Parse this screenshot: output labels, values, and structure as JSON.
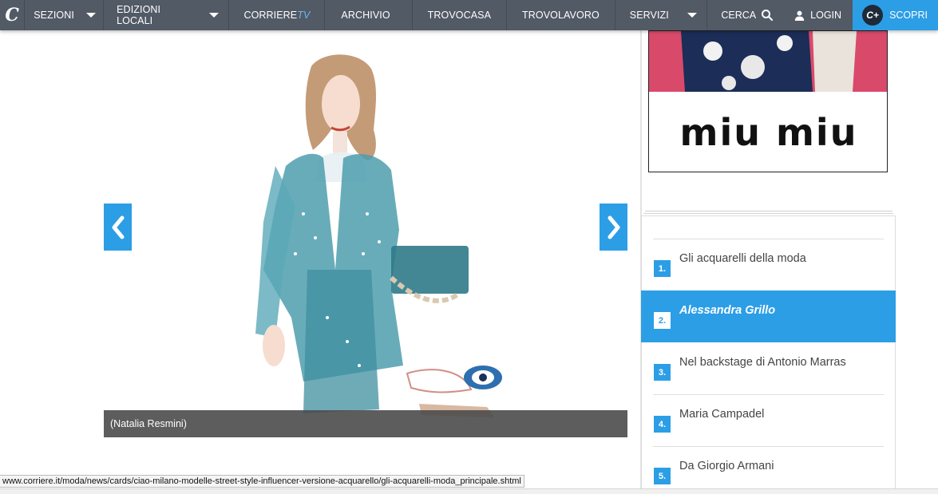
{
  "nav": {
    "logo": "C",
    "items": [
      "SEZIONI",
      "EDIZIONI LOCALI",
      "CORRIERE",
      "TV",
      "ARCHIVIO",
      "TROVOCASA",
      "TROVOLAVORO",
      "SERVIZI",
      "CERCA",
      "LOGIN",
      "SCOPRI"
    ],
    "cplus": "C+"
  },
  "gallery": {
    "caption": "(Natalia Resmini)"
  },
  "ad": {
    "brand": "miu miu"
  },
  "list": [
    {
      "num": "1.",
      "title": "Gli acquarelli della moda"
    },
    {
      "num": "2.",
      "title": "Alessandra Grillo"
    },
    {
      "num": "3.",
      "title": "Nel backstage di Antonio Marras"
    },
    {
      "num": "4.",
      "title": "Maria Campadel"
    },
    {
      "num": "5.",
      "title": "Da Giorgio Armani"
    }
  ],
  "status": {
    "url": "www.corriere.it/moda/news/cards/ciao-milano-modelle-street-style-influencer-versione-acquarello/gli-acquarelli-moda_principale.shtml"
  },
  "colors": {
    "nav_bg": "#525a66",
    "accent": "#2c9ee6",
    "caption_bg": "#4b4b4b"
  }
}
